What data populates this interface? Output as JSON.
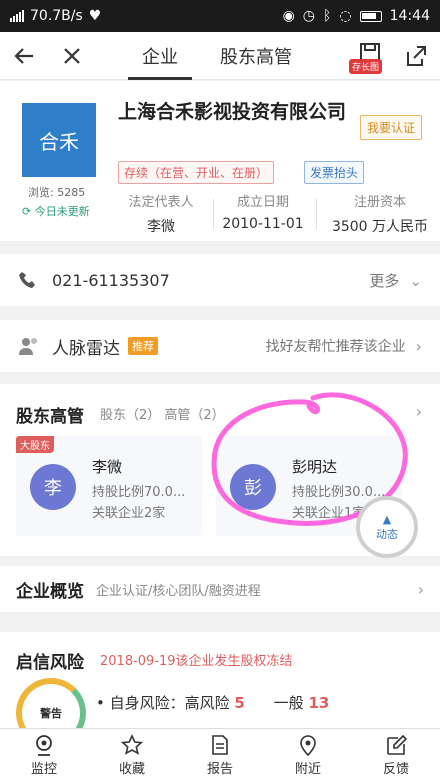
{
  "status_bar": {
    "speed": "70.7B/s",
    "time": "14:44"
  },
  "nav": {
    "tabs": [
      "企业",
      "股东高管"
    ],
    "save_badge": "存长图"
  },
  "company": {
    "logo_text": "合禾",
    "name": "上海合禾影视投资有限公司",
    "browse": "浏览: 5285",
    "updated": "今日未更新",
    "claim": "我要认证",
    "status": "存续（在营、开业、在册）",
    "invoice": "发票抬头",
    "legal_rep_label": "法定代表人",
    "legal_rep": "李微",
    "founded_label": "成立日期",
    "founded": "2010-11-01",
    "capital_label": "注册资本",
    "capital": "3500 万人民币"
  },
  "phone": {
    "number": "021-61135307",
    "more": "更多"
  },
  "radar": {
    "title": "人脉雷达",
    "badge": "推荐",
    "hint": "找好友帮忙推荐该企业"
  },
  "shareholders": {
    "title": "股东高管",
    "sub": "股东（2） 高管（2）",
    "people": [
      {
        "tag": "大股东",
        "avatar": "李",
        "name": "李微",
        "ratio": "持股比例70.0...",
        "related": "关联企业2家"
      },
      {
        "avatar": "彭",
        "name": "彭明达",
        "ratio": "持股比例30.0...",
        "related": "关联企业1家"
      }
    ],
    "dynamic": "动态"
  },
  "overview": {
    "title": "企业概览",
    "sub": "企业认证/核心团队/融资进程"
  },
  "risk": {
    "title": "启信风险",
    "news": "2018-09-19该企业发生股权冻结",
    "gauge": "警告",
    "self_label": "自身风险：高风险",
    "self_count": "5",
    "general_label": "一般",
    "general_count": "13"
  },
  "tabbar": [
    "监控",
    "收藏",
    "报告",
    "附近",
    "反馈"
  ],
  "colors": {
    "accent": "#2f7ec9",
    "danger": "#e05d5d",
    "highlight": "#f0b63a",
    "annotation": "#ff4fd8"
  }
}
